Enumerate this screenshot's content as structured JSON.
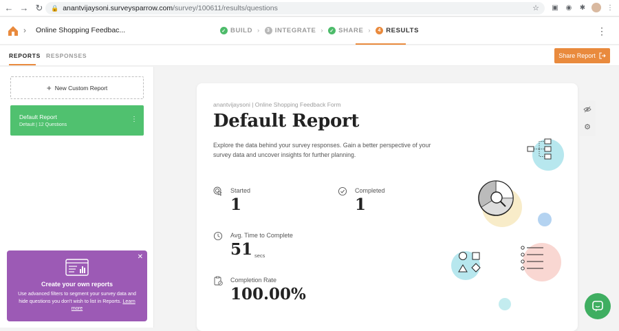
{
  "browser": {
    "url_host": "anantvijaysoni.surveysparrow.com",
    "url_path": "/survey/100611/results/questions"
  },
  "header": {
    "survey_name": "Online Shopping Feedbac...",
    "steps": [
      {
        "label": "BUILD",
        "state": "done"
      },
      {
        "label": "INTEGRATE",
        "state": "numbered",
        "number": "3"
      },
      {
        "label": "SHARE",
        "state": "done"
      },
      {
        "label": "RESULTS",
        "state": "active",
        "number": "4"
      }
    ]
  },
  "subnav": {
    "tabs": [
      {
        "label": "REPORTS",
        "active": true
      },
      {
        "label": "RESPONSES",
        "active": false
      }
    ],
    "share_button": "Share Report"
  },
  "sidebar": {
    "new_report_label": "New Custom Report",
    "report": {
      "title": "Default Report",
      "meta": "Default  |  12 Questions"
    }
  },
  "promo": {
    "title": "Create your own reports",
    "body": "Use advanced filters to segment your survey data and hide questions you don't wish to list in Reports.",
    "link": "Learn more"
  },
  "report": {
    "breadcrumb": "anantvijaysoni  |  Online Shopping Feedback Form",
    "title": "Default Report",
    "description": "Explore the data behind your survey responses. Gain a better perspective of your survey data and uncover insights for further planning.",
    "stats": {
      "started": {
        "label": "Started",
        "value": "1"
      },
      "completed": {
        "label": "Completed",
        "value": "1"
      },
      "avg_time": {
        "label": "Avg. Time to Complete",
        "value": "51",
        "unit": "secs"
      },
      "completion_rate": {
        "label": "Completion Rate",
        "value": "100.00%"
      }
    }
  },
  "colors": {
    "accent": "#e98a3d",
    "success": "#50c16f",
    "promo": "#9c5ab5",
    "chat": "#3fae61"
  }
}
